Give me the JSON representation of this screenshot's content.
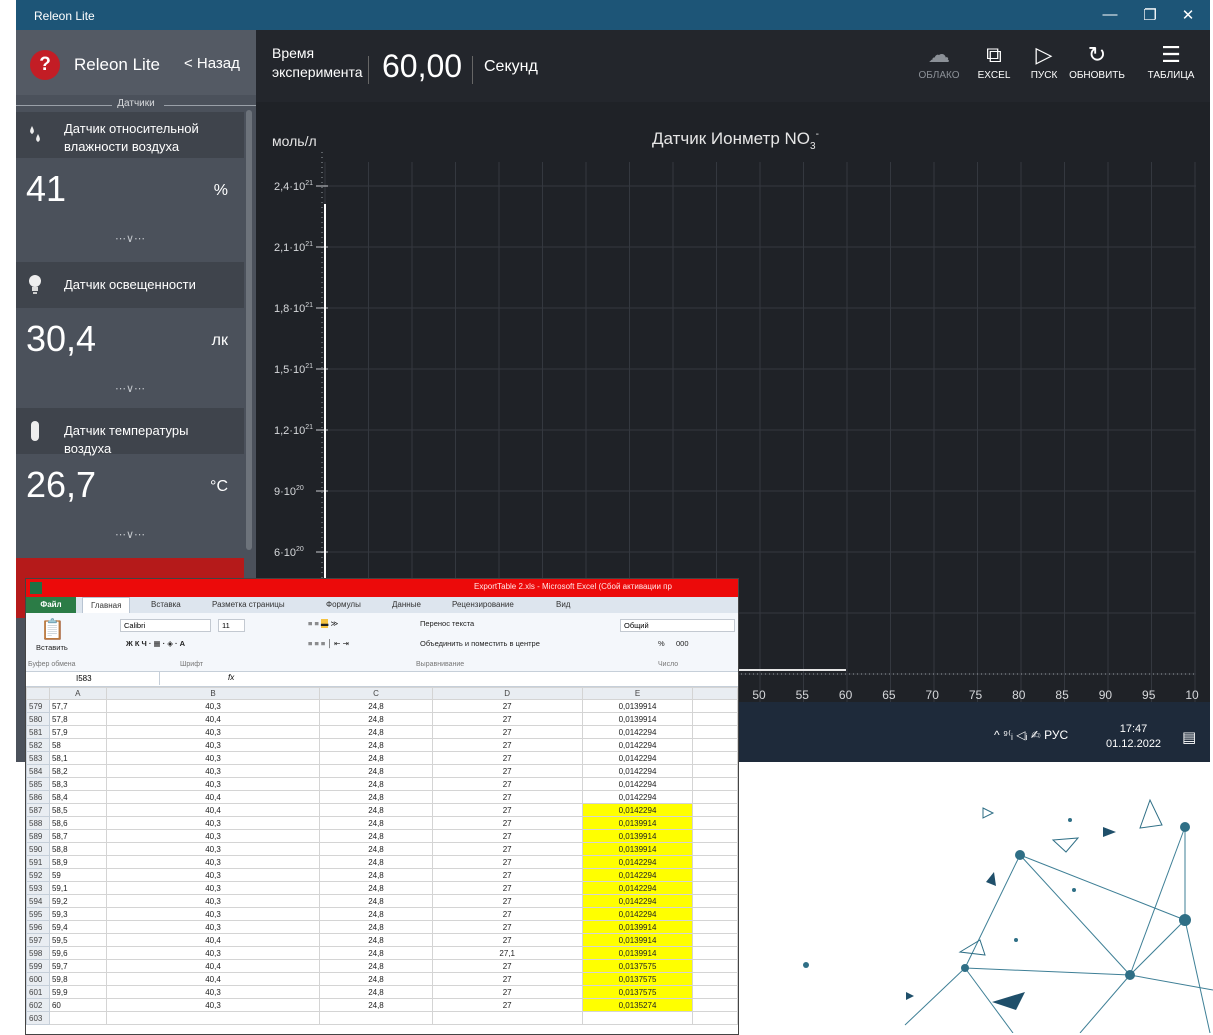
{
  "window": {
    "title": "Releon Lite",
    "controls": {
      "minimize": "—",
      "restore": "❐",
      "close": "✕"
    }
  },
  "sidebar": {
    "app_name": "Releon Lite",
    "back_label": "< Назад",
    "section_title": "Датчики",
    "sensors": [
      {
        "name": "Датчик относительной влажности воздуха",
        "value": "41",
        "unit": "%",
        "icon": "humidity-drops-icon"
      },
      {
        "name": "Датчик освещенности",
        "value": "30,4",
        "unit": "лк",
        "icon": "bulb-icon"
      },
      {
        "name": "Датчик температуры воздуха",
        "value": "26,7",
        "unit": "°C",
        "icon": "thermometer-icon"
      }
    ],
    "more_glyph": "⋯∨⋯"
  },
  "toolbar": {
    "time_label_1": "Время",
    "time_label_2": "эксперимента",
    "time_value": "60,00",
    "time_unit": "Секунд",
    "buttons": [
      {
        "label": "ОБЛАКО",
        "icon": "cloud-icon",
        "enabled": false
      },
      {
        "label": "EXCEL",
        "icon": "excel-icon",
        "enabled": true
      },
      {
        "label": "ПУСК",
        "icon": "play-icon",
        "enabled": true
      },
      {
        "label": "ОБНОВИТЬ",
        "icon": "refresh-icon",
        "enabled": true
      },
      {
        "label": "ТАБЛИЦА",
        "icon": "table-icon",
        "enabled": true
      }
    ]
  },
  "chart_data": {
    "type": "line",
    "title": "Датчик Ионметр NO",
    "title_sub": "3",
    "title_sup": "-",
    "ylabel": "моль/л",
    "y_ticks": [
      {
        "base": "2,4·10",
        "exp": "21"
      },
      {
        "base": "2,1·10",
        "exp": "21"
      },
      {
        "base": "1,8·10",
        "exp": "21"
      },
      {
        "base": "1,5·10",
        "exp": "21"
      },
      {
        "base": "1,2·10",
        "exp": "21"
      },
      {
        "base": "9·10",
        "exp": "20"
      },
      {
        "base": "6·10",
        "exp": "20"
      }
    ],
    "x_ticks": [
      "50",
      "55",
      "60",
      "65",
      "70",
      "75",
      "80",
      "85",
      "90",
      "95",
      "10"
    ],
    "grid": true,
    "series": []
  },
  "taskbar": {
    "tray": "^ ⁹⁽ᵢ ◁ᵢ ✍ РУС",
    "time": "17:47",
    "date": "01.12.2022",
    "notifications_icon": "notification-icon"
  },
  "excel": {
    "title": "ExportTable 2.xls - Microsoft Excel (Сбой активации пр",
    "tabs": [
      "Файл",
      "Главная",
      "Вставка",
      "Разметка страницы",
      "Формулы",
      "Данные",
      "Рецензирование",
      "Вид"
    ],
    "ribbon": {
      "paste": "Вставить",
      "font_name": "Calibri",
      "font_size": "11",
      "wrap_text": "Перенос текста",
      "merge_center": "Объединить и поместить в центре",
      "number_format": "Общий",
      "percent": "%",
      "thousands": "000",
      "groups": [
        "Буфер обмена",
        "Шрифт",
        "Выравнивание",
        "Число"
      ]
    },
    "name_box": "I583",
    "fx": "fx",
    "columns": [
      "",
      "A",
      "B",
      "C",
      "D",
      "E"
    ],
    "rows": [
      {
        "n": "579",
        "a": "57,7",
        "b": "40,3",
        "c": "24,8",
        "d": "27",
        "e": "0,0139914",
        "hl": false
      },
      {
        "n": "580",
        "a": "57,8",
        "b": "40,4",
        "c": "24,8",
        "d": "27",
        "e": "0,0139914",
        "hl": false
      },
      {
        "n": "581",
        "a": "57,9",
        "b": "40,3",
        "c": "24,8",
        "d": "27",
        "e": "0,0142294",
        "hl": false
      },
      {
        "n": "582",
        "a": "58",
        "b": "40,3",
        "c": "24,8",
        "d": "27",
        "e": "0,0142294",
        "hl": false
      },
      {
        "n": "583",
        "a": "58,1",
        "b": "40,3",
        "c": "24,8",
        "d": "27",
        "e": "0,0142294",
        "hl": false
      },
      {
        "n": "584",
        "a": "58,2",
        "b": "40,3",
        "c": "24,8",
        "d": "27",
        "e": "0,0142294",
        "hl": false
      },
      {
        "n": "585",
        "a": "58,3",
        "b": "40,3",
        "c": "24,8",
        "d": "27",
        "e": "0,0142294",
        "hl": false
      },
      {
        "n": "586",
        "a": "58,4",
        "b": "40,4",
        "c": "24,8",
        "d": "27",
        "e": "0,0142294",
        "hl": false
      },
      {
        "n": "587",
        "a": "58,5",
        "b": "40,4",
        "c": "24,8",
        "d": "27",
        "e": "0,0142294",
        "hl": true
      },
      {
        "n": "588",
        "a": "58,6",
        "b": "40,3",
        "c": "24,8",
        "d": "27",
        "e": "0,0139914",
        "hl": true
      },
      {
        "n": "589",
        "a": "58,7",
        "b": "40,3",
        "c": "24,8",
        "d": "27",
        "e": "0,0139914",
        "hl": true
      },
      {
        "n": "590",
        "a": "58,8",
        "b": "40,3",
        "c": "24,8",
        "d": "27",
        "e": "0,0139914",
        "hl": true
      },
      {
        "n": "591",
        "a": "58,9",
        "b": "40,3",
        "c": "24,8",
        "d": "27",
        "e": "0,0142294",
        "hl": true
      },
      {
        "n": "592",
        "a": "59",
        "b": "40,3",
        "c": "24,8",
        "d": "27",
        "e": "0,0142294",
        "hl": true
      },
      {
        "n": "593",
        "a": "59,1",
        "b": "40,3",
        "c": "24,8",
        "d": "27",
        "e": "0,0142294",
        "hl": true
      },
      {
        "n": "594",
        "a": "59,2",
        "b": "40,3",
        "c": "24,8",
        "d": "27",
        "e": "0,0142294",
        "hl": true
      },
      {
        "n": "595",
        "a": "59,3",
        "b": "40,3",
        "c": "24,8",
        "d": "27",
        "e": "0,0142294",
        "hl": true
      },
      {
        "n": "596",
        "a": "59,4",
        "b": "40,3",
        "c": "24,8",
        "d": "27",
        "e": "0,0139914",
        "hl": true
      },
      {
        "n": "597",
        "a": "59,5",
        "b": "40,4",
        "c": "24,8",
        "d": "27",
        "e": "0,0139914",
        "hl": true
      },
      {
        "n": "598",
        "a": "59,6",
        "b": "40,3",
        "c": "24,8",
        "d": "27,1",
        "e": "0,0139914",
        "hl": true
      },
      {
        "n": "599",
        "a": "59,7",
        "b": "40,4",
        "c": "24,8",
        "d": "27",
        "e": "0,0137575",
        "hl": true
      },
      {
        "n": "600",
        "a": "59,8",
        "b": "40,4",
        "c": "24,8",
        "d": "27",
        "e": "0,0137575",
        "hl": true
      },
      {
        "n": "601",
        "a": "59,9",
        "b": "40,3",
        "c": "24,8",
        "d": "27",
        "e": "0,0137575",
        "hl": true
      },
      {
        "n": "602",
        "a": "60",
        "b": "40,3",
        "c": "24,8",
        "d": "27",
        "e": "0,0135274",
        "hl": true
      },
      {
        "n": "603",
        "a": "",
        "b": "",
        "c": "",
        "d": "",
        "e": "",
        "hl": false
      }
    ]
  },
  "colors": {
    "releon_bg": "#23262c",
    "sidebar": "#4b515b",
    "excel_title": "#ec0a0a",
    "highlight": "#ffff00",
    "accent_red": "#c31d25"
  }
}
